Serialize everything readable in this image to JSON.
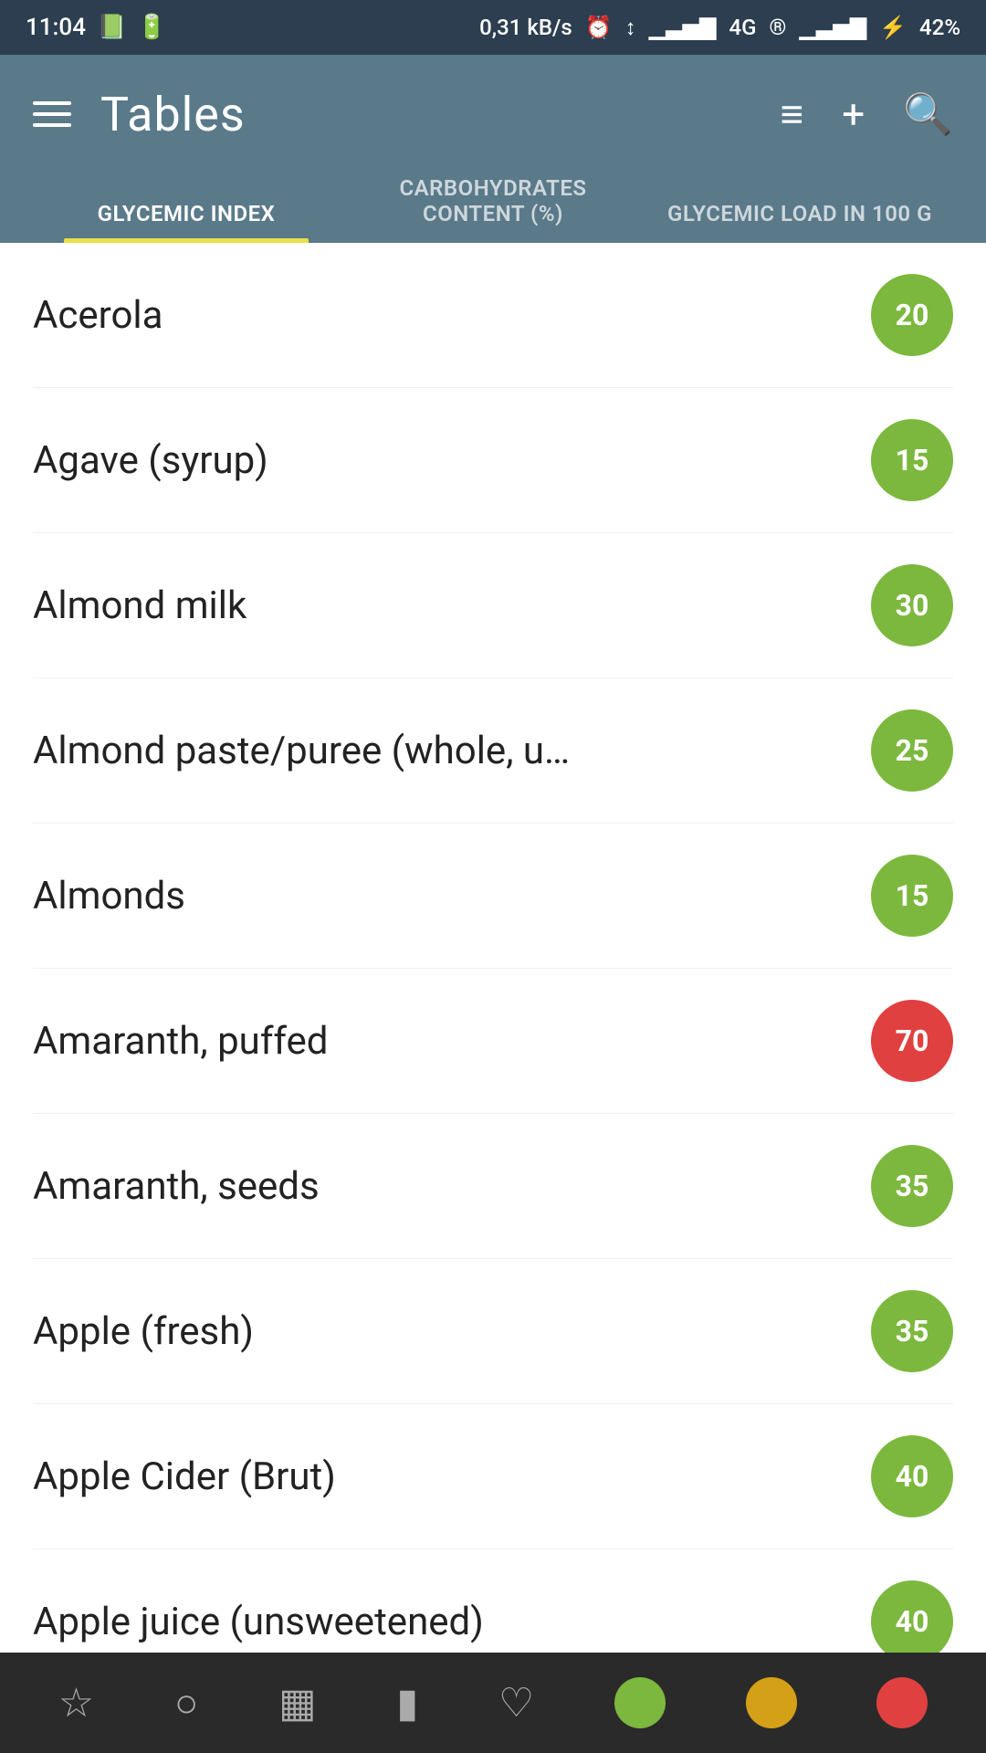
{
  "statusBar": {
    "time": "11:04",
    "speed": "0,31 kB/s",
    "battery": "42%"
  },
  "header": {
    "title": "Tables",
    "filterIcon": "≡",
    "addIcon": "+",
    "searchIcon": "🔍"
  },
  "tabs": [
    {
      "id": "glycemic-index",
      "label": "GLYCEMIC INDEX",
      "active": true
    },
    {
      "id": "carbohydrates",
      "label": "CARBOHYDRATES CONTENT (%)",
      "active": false
    },
    {
      "id": "glycemic-load",
      "label": "GLYCEMIC LOAD in 100 g",
      "active": false
    }
  ],
  "foods": [
    {
      "name": "Acerola",
      "value": 20,
      "color": "green"
    },
    {
      "name": "Agave (syrup)",
      "value": 15,
      "color": "green"
    },
    {
      "name": "Almond milk",
      "value": 30,
      "color": "green"
    },
    {
      "name": "Almond paste/puree (whole, u…",
      "value": 25,
      "color": "green"
    },
    {
      "name": "Almonds",
      "value": 15,
      "color": "green"
    },
    {
      "name": "Amaranth, puffed",
      "value": 70,
      "color": "red"
    },
    {
      "name": "Amaranth, seeds",
      "value": 35,
      "color": "green"
    },
    {
      "name": "Apple (fresh)",
      "value": 35,
      "color": "green"
    },
    {
      "name": "Apple Cider (Brut)",
      "value": 40,
      "color": "green"
    },
    {
      "name": "Apple juice (unsweetened)",
      "value": 40,
      "color": "green",
      "partial": true
    }
  ],
  "bottomNav": {
    "icons": [
      "☆",
      "○",
      "▦",
      "▮",
      "♡"
    ],
    "legend": [
      "green",
      "yellow",
      "red"
    ]
  }
}
